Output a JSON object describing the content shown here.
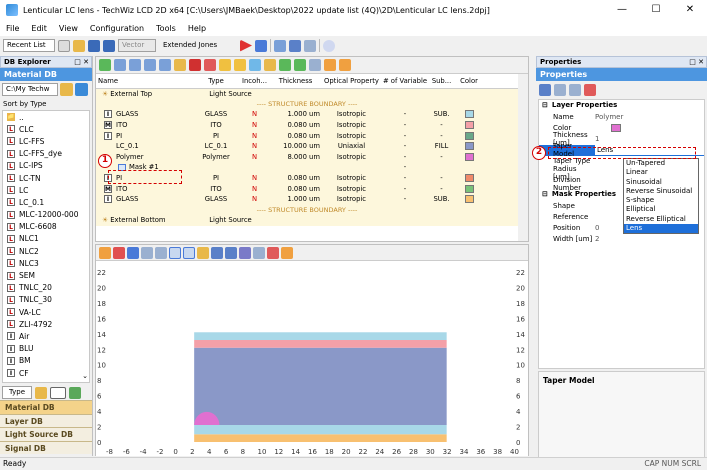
{
  "window": {
    "title": "Lenticular LC lens - TechWiz LCD 2D x64 [C:\\Users\\JMBaek\\Desktop\\2022 update list (4Q)\\2D\\Lenticular LC lens.2dpj]",
    "minimize": "—",
    "maximize": "☐",
    "close": "✕"
  },
  "menu": [
    "File",
    "Edit",
    "View",
    "Configuration",
    "Tools",
    "Help"
  ],
  "toolbar": {
    "recent_list": "Recent List",
    "vector": "Vector",
    "extended_jones": "Extended Jones"
  },
  "db_explorer": {
    "title": "DB Explorer",
    "pin": "□ ✕",
    "header": "Material DB",
    "path": "C:\\My Techw",
    "sort": "Sort by Type",
    "items": [
      {
        "icon": "📁",
        "label": ".."
      },
      {
        "icon": "L",
        "label": "CLC"
      },
      {
        "icon": "L",
        "label": "LC-FFS"
      },
      {
        "icon": "L",
        "label": "LC-FFS_dye"
      },
      {
        "icon": "L",
        "label": "LC-IPS"
      },
      {
        "icon": "L",
        "label": "LC-TN"
      },
      {
        "icon": "L",
        "label": "LC"
      },
      {
        "icon": "L",
        "label": "LC_0.1"
      },
      {
        "icon": "L",
        "label": "MLC-12000-000"
      },
      {
        "icon": "L",
        "label": "MLC-6608"
      },
      {
        "icon": "L",
        "label": "NLC1"
      },
      {
        "icon": "L",
        "label": "NLC2"
      },
      {
        "icon": "L",
        "label": "NLC3"
      },
      {
        "icon": "L",
        "label": "SEM"
      },
      {
        "icon": "L",
        "label": "TNLC_20"
      },
      {
        "icon": "L",
        "label": "TNLC_30"
      },
      {
        "icon": "L",
        "label": "VA-LC"
      },
      {
        "icon": "L",
        "label": "ZLI-4792"
      },
      {
        "icon": "I",
        "label": "Air"
      },
      {
        "icon": "I",
        "label": "BLU"
      },
      {
        "icon": "I",
        "label": "BM"
      },
      {
        "icon": "I",
        "label": "CF"
      }
    ],
    "type_button": "Type",
    "tabs": [
      "Material DB",
      "Layer DB",
      "Light Source DB",
      "Signal DB"
    ]
  },
  "structure_table": {
    "columns": [
      "Name",
      "Type",
      "Incoh...",
      "Thickness",
      "Optical Property",
      "# of Variable",
      "Sub...",
      "Color"
    ],
    "boundary_text": "---- STRUCTURE BOUNDARY ----",
    "external_top": {
      "name": "External Top",
      "type": "Light Source"
    },
    "external_bottom": {
      "name": "External Bottom",
      "type": "Light Source"
    },
    "rows": [
      {
        "icon": "I",
        "name": "GLASS",
        "type": "GLASS",
        "incoh": "N",
        "thickness": "1.000 um",
        "optical": "Isotropic",
        "vars": "-",
        "sub": "SUB.",
        "color": "#a8d8e8"
      },
      {
        "icon": "M",
        "name": "ITO",
        "type": "ITO",
        "incoh": "N",
        "thickness": "0.080 um",
        "optical": "Isotropic",
        "vars": "-",
        "sub": "-",
        "color": "#f4a0a8"
      },
      {
        "icon": "I",
        "name": "PI",
        "type": "PI",
        "incoh": "N",
        "thickness": "0.080 um",
        "optical": "Isotropic",
        "vars": "-",
        "sub": "-",
        "color": "#6aa88a"
      },
      {
        "icon": "",
        "name": "LC_0.1",
        "type": "LC_0.1",
        "incoh": "N",
        "thickness": "10.000 um",
        "optical": "Uniaxial",
        "vars": "-",
        "sub": "FILL",
        "color": "#8a98c8"
      },
      {
        "icon": "",
        "name": "Polymer",
        "type": "Polymer",
        "incoh": "N",
        "thickness": "8.000 um",
        "optical": "Isotropic",
        "vars": "-",
        "sub": "-",
        "color": "#e070d0"
      },
      {
        "icon": "",
        "name": "Mask #1",
        "type": "",
        "incoh": "",
        "thickness": "",
        "optical": "",
        "vars": "-",
        "sub": "",
        "color": ""
      },
      {
        "icon": "I",
        "name": "PI",
        "type": "PI",
        "incoh": "N",
        "thickness": "0.080 um",
        "optical": "Isotropic",
        "vars": "-",
        "sub": "-",
        "color": "#f08a6a"
      },
      {
        "icon": "M",
        "name": "ITO",
        "type": "ITO",
        "incoh": "N",
        "thickness": "0.080 um",
        "optical": "Isotropic",
        "vars": "-",
        "sub": "-",
        "color": "#7ac27a"
      },
      {
        "icon": "I",
        "name": "GLASS",
        "type": "GLASS",
        "incoh": "N",
        "thickness": "1.000 um",
        "optical": "Isotropic",
        "vars": "-",
        "sub": "SUB.",
        "color": "#f8c070"
      }
    ]
  },
  "plot": {
    "y_ticks": [
      "22",
      "20",
      "18",
      "16",
      "14",
      "12",
      "10",
      "8",
      "6",
      "4",
      "2",
      "0"
    ],
    "x_ticks": [
      "-8",
      "-6",
      "-4",
      "-2",
      "0",
      "2",
      "4",
      "6",
      "8",
      "10",
      "12",
      "14",
      "16",
      "18",
      "20",
      "22",
      "24",
      "26",
      "28",
      "30",
      "32",
      "34",
      "36",
      "38",
      "40"
    ],
    "colors": {
      "top_glass": "#a8d8e8",
      "top_ito": "#f4a0a8",
      "lc": "#8a98c8",
      "bottom_pi": "#f8c070",
      "polymer": "#e070d0"
    }
  },
  "properties": {
    "title": "Properties",
    "header": "Properties",
    "layer_section": "Layer Properties",
    "mask_section": "Mask Properties",
    "rows": [
      {
        "k": "Name",
        "v": "Polymer"
      },
      {
        "k": "Color",
        "v": ""
      },
      {
        "k": "Thickness [um]",
        "v": "1"
      },
      {
        "k": "Taper Model",
        "v": "Lens"
      },
      {
        "k": "Taper Type",
        "v": ""
      },
      {
        "k": "Radius [um]",
        "v": ""
      },
      {
        "k": "Division Number",
        "v": ""
      }
    ],
    "mask_rows": [
      {
        "k": "Shape",
        "v": ""
      },
      {
        "k": "Reference",
        "v": ""
      },
      {
        "k": "Position",
        "v": "0"
      },
      {
        "k": "Width [um]",
        "v": "2"
      }
    ],
    "dropdown_options": [
      "Un-Tapered",
      "Linear",
      "Sinusoidal",
      "Reverse Sinusoidal",
      "S-shape",
      "Elliptical",
      "Reverse Elliptical",
      "Lens"
    ],
    "selected_option": "Lens",
    "description_title": "Taper Model"
  },
  "callouts": {
    "one": "1",
    "two": "2"
  },
  "status": {
    "left": "Ready",
    "right": "CAP  NUM  SCRL"
  }
}
